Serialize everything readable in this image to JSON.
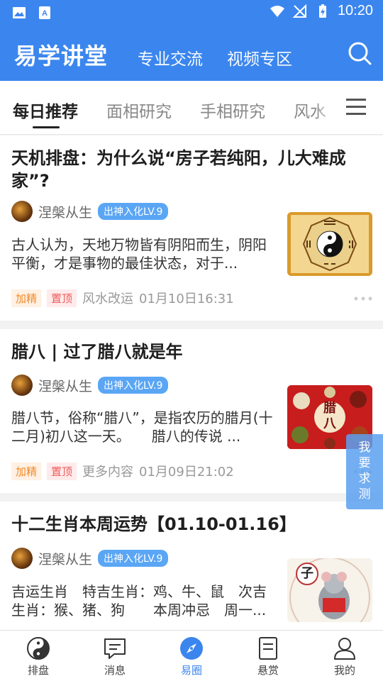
{
  "status_bar": {
    "time": "10:20"
  },
  "app_bar": {
    "title": "易学讲堂",
    "links": [
      "专业交流",
      "视频专区"
    ]
  },
  "tabs": [
    "每日推荐",
    "面相研究",
    "手相研究",
    "风水"
  ],
  "posts": [
    {
      "title": "天机排盘：为什么说“房子若纯阳，儿大难成家”?",
      "author": "涅槃从生",
      "level": "出神入化LV.9",
      "excerpt": "古人认为，天地万物皆有阴阳而生，阴阳平衡，才是事物的最佳状态，对于...",
      "tags": [
        "加精",
        "置顶"
      ],
      "category": "风水改运",
      "date": "01月10日16:31",
      "thumb_icon": "bagua-image"
    },
    {
      "title": "腊八 | 过了腊八就是年",
      "author": "涅槃从生",
      "level": "出神入化LV.9",
      "excerpt": "腊八节，俗称“腊八”，是指农历的腊月(十二月)初八这一天。　　腊八的传说 ...",
      "tags": [
        "加精",
        "置顶"
      ],
      "category": "更多内容",
      "date": "01月09日21:02",
      "thumb_icon": "laba-porridge-image",
      "thumb_text": "腊八"
    },
    {
      "title": "十二生肖本周运势【01.10-01.16】",
      "author": "涅槃从生",
      "level": "出神入化LV.9",
      "excerpt": "吉运生肖　特吉生肖：鸡、牛、鼠　次吉生肖：猴、猪、狗　　本周冲忌　周一...",
      "thumb_icon": "zodiac-rat-image",
      "thumb_text": "子"
    }
  ],
  "float_button": "我要求测",
  "bottom_nav": [
    {
      "label": "排盘",
      "icon": "yinyang-icon"
    },
    {
      "label": "消息",
      "icon": "message-icon"
    },
    {
      "label": "易圈",
      "icon": "compass-icon",
      "active": true
    },
    {
      "label": "悬赏",
      "icon": "document-icon"
    },
    {
      "label": "我的",
      "icon": "user-icon"
    }
  ],
  "colors": {
    "primary": "#3b86ee",
    "badge": "#5aa6f5",
    "tag_jj": "#f08a2b",
    "tag_zd": "#ef5b5b"
  }
}
